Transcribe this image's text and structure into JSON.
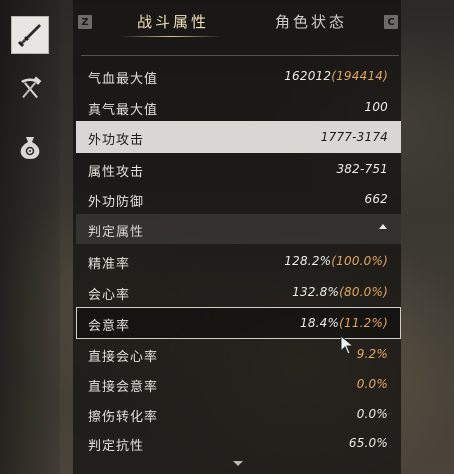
{
  "sidebar": {
    "items": [
      {
        "icon": "blade-weapon-icon",
        "active": true
      },
      {
        "icon": "pickaxe-hammer-icon",
        "active": false
      },
      {
        "icon": "money-bag-icon",
        "active": false
      }
    ]
  },
  "tabs": {
    "left_key": "Z",
    "right_key": "C",
    "items": [
      {
        "label": "战斗属性",
        "active": true
      },
      {
        "label": "角色状态",
        "active": false
      }
    ]
  },
  "stats": [
    {
      "label": "气血最大值",
      "value": "162012",
      "extra": "(194414)"
    },
    {
      "label": "真气最大值",
      "value": "100"
    },
    {
      "label": "外功攻击",
      "value": "1777-3174"
    },
    {
      "label": "属性攻击",
      "value": "382-751"
    },
    {
      "label": "外功防御",
      "value": "662"
    }
  ],
  "section": {
    "label": "判定属性"
  },
  "judge": [
    {
      "label": "精准率",
      "value": "128.2%",
      "extra": "(100.0%)"
    },
    {
      "label": "会心率",
      "value": "132.8%",
      "extra": "(80.0%)"
    },
    {
      "label": "会意率",
      "value": "18.4%",
      "extra": "(11.2%)"
    },
    {
      "label": "直接会心率",
      "value": "9.2%"
    },
    {
      "label": "直接会意率",
      "value": "0.0%"
    },
    {
      "label": "擦伤转化率",
      "value": "0.0%"
    },
    {
      "label": "判定抗性",
      "value": "65.0%"
    }
  ],
  "colors": {
    "accent": "#e2a75f",
    "highlight_bg": "#d9d7d3",
    "title_gold": "#efe0b8"
  }
}
